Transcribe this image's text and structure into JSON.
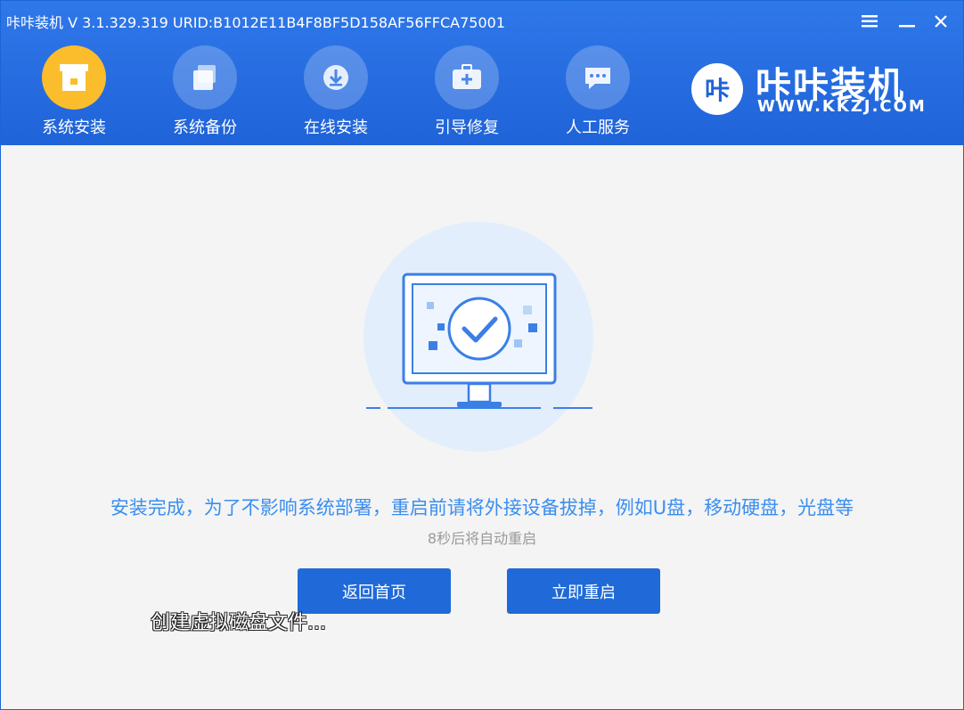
{
  "window": {
    "title": "咔咔装机 V 3.1.329.319 URID:B1012E11B4F8BF5D158AF56FFCA75001"
  },
  "nav": {
    "items": [
      {
        "label": "系统安装",
        "icon": "system-install-icon",
        "active": true
      },
      {
        "label": "系统备份",
        "icon": "system-backup-icon",
        "active": false
      },
      {
        "label": "在线安装",
        "icon": "online-install-icon",
        "active": false
      },
      {
        "label": "引导修复",
        "icon": "boot-repair-icon",
        "active": false
      },
      {
        "label": "人工服务",
        "icon": "chat-service-icon",
        "active": false
      }
    ]
  },
  "brand": {
    "logo_text": "咔",
    "name": "咔咔装机",
    "url": "WWW.KKZJ.COM"
  },
  "content": {
    "message": "安装完成，为了不影响系统部署，重启前请将外接设备拔掉，例如U盘，移动硬盘，光盘等",
    "countdown": "8秒后将自动重启",
    "home_button": "返回首页",
    "restart_button": "立即重启",
    "overlay_status": "创建虚拟磁盘文件..."
  },
  "colors": {
    "header_blue": "#1f63d8",
    "accent_blue": "#3a8ef0",
    "active_nav": "#fbbd2b",
    "button_blue": "#1f6ad8"
  }
}
